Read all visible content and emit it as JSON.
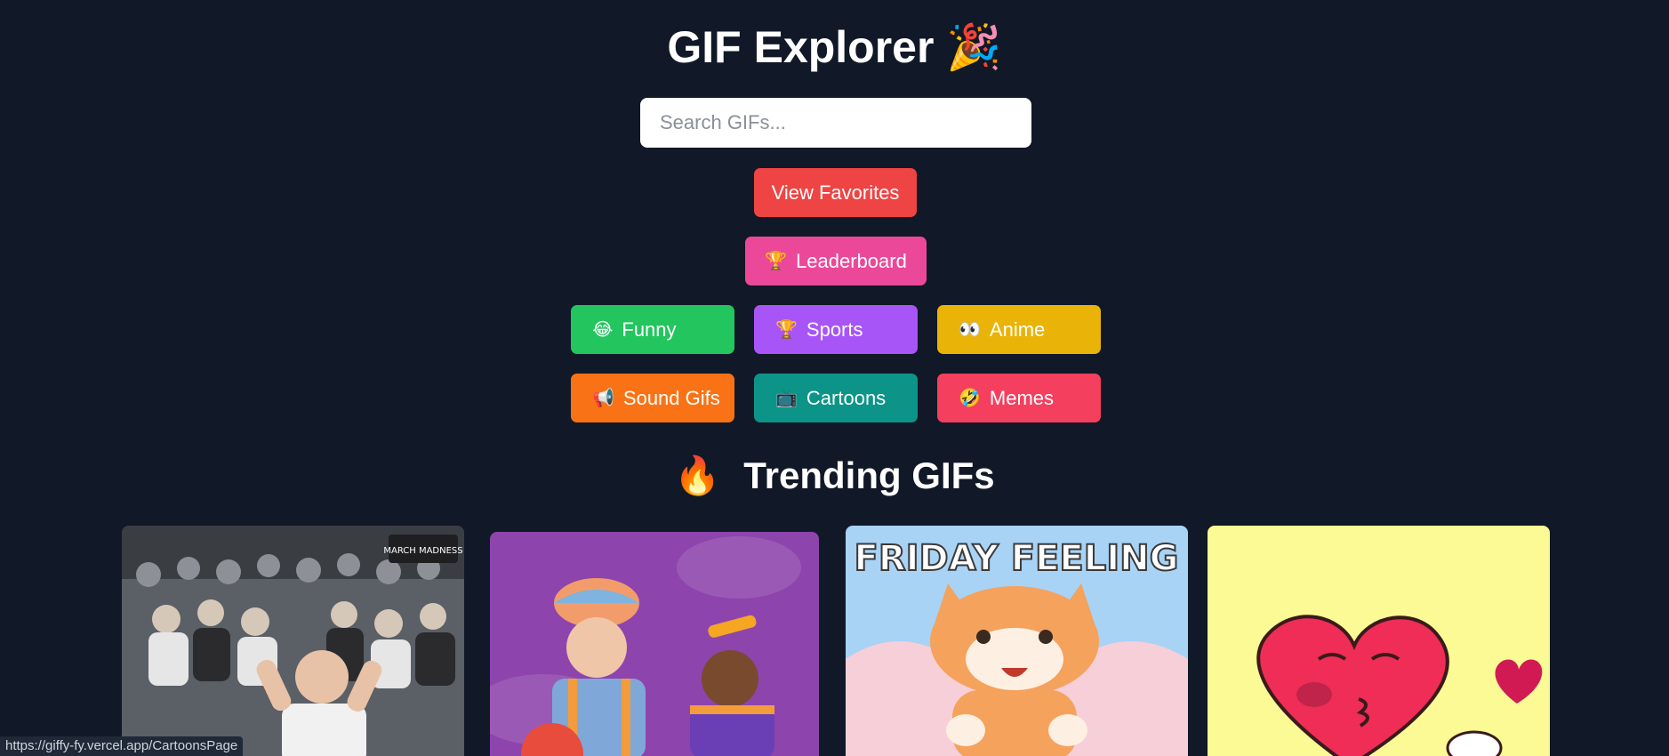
{
  "header": {
    "title": "GIF Explorer",
    "title_emoji": "🎉"
  },
  "search": {
    "placeholder": "Search GIFs...",
    "value": ""
  },
  "buttons": {
    "favorites": {
      "label": "View Favorites",
      "color": "#ef4444"
    },
    "leaderboard": {
      "label": "Leaderboard",
      "icon": "🏆",
      "color": "#ec4899"
    }
  },
  "categories": [
    {
      "label": "Funny",
      "icon": "😂",
      "color": "#22c55e"
    },
    {
      "label": "Sports",
      "icon": "🏆",
      "color": "#a855f7"
    },
    {
      "label": "Anime",
      "icon": "👀",
      "color": "#eab308"
    },
    {
      "label": "Sound Gifs",
      "icon": "📢",
      "color": "#f97316"
    },
    {
      "label": "Cartoons",
      "icon": "📺",
      "color": "#0d9488"
    },
    {
      "label": "Memes",
      "icon": "🤣",
      "color": "#f43f5e"
    }
  ],
  "trending": {
    "title": "Trending GIFs",
    "icon": "🔥",
    "gifs": [
      {
        "name": "crowd-celebration-gif",
        "badge": "MARCH MADNESS"
      },
      {
        "name": "kids-show-gif"
      },
      {
        "name": "friday-feeling-cat-gif",
        "caption": "FRIDAY FEELING"
      },
      {
        "name": "kissing-heart-gif"
      }
    ]
  },
  "status_bar": {
    "url": "https://giffy-fy.vercel.app/CartoonsPage"
  }
}
